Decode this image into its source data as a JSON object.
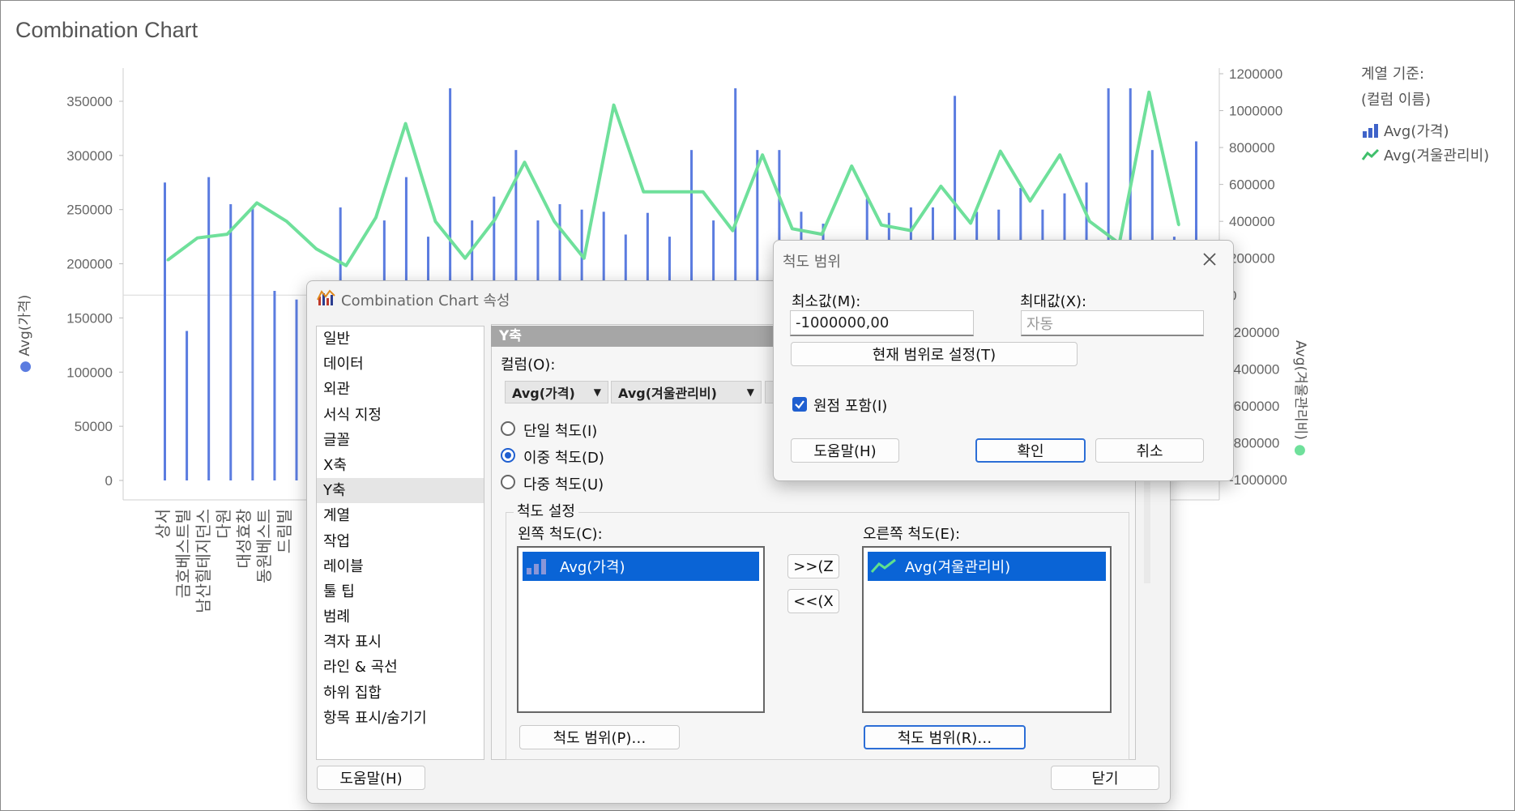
{
  "chart": {
    "title": "Combination Chart",
    "left_axis_title": "Avg(가격)",
    "right_axis_title": "Avg(겨울관리비)",
    "left_ticks": [
      "0",
      "50000",
      "100000",
      "150000",
      "200000",
      "250000",
      "300000",
      "350000"
    ],
    "right_ticks": [
      "1200000",
      "1000000",
      "800000",
      "600000",
      "400000",
      "200000",
      "0",
      "-200000",
      "-400000",
      "-600000",
      "-800000",
      "-1000000"
    ],
    "x_labels": [
      "상서",
      "금호베스트빌",
      "남산힐테지던스",
      "다원",
      "대성효창",
      "동원베스트",
      "드림빌"
    ],
    "bar_color": "#5b7ce0",
    "line_color": "#6fe09b"
  },
  "chart_data": {
    "type": "bar",
    "series": [
      {
        "name": "Avg(가격)",
        "type": "bar",
        "axis": "left",
        "values": [
          275000,
          138000,
          280000,
          255000,
          252000,
          175000,
          167000,
          167000,
          252000,
          145000,
          240000,
          280000,
          225000,
          362000,
          240000,
          262000,
          305000,
          240000,
          255000,
          250000,
          248000,
          227000,
          247000,
          225000,
          305000,
          240000,
          362000,
          305000,
          305000,
          248000,
          237000,
          202000,
          260000,
          247000,
          252000,
          252000,
          355000,
          248000,
          250000,
          270000,
          250000,
          265000,
          275000,
          362000,
          362000,
          305000,
          225000,
          313000
        ]
      },
      {
        "name": "Avg(겨울관리비)",
        "type": "line",
        "axis": "right",
        "values": [
          190000,
          310000,
          330000,
          500000,
          400000,
          250000,
          160000,
          420000,
          930000,
          400000,
          200000,
          410000,
          720000,
          400000,
          200000,
          1030000,
          560000,
          560000,
          560000,
          350000,
          760000,
          360000,
          330000,
          700000,
          380000,
          350000,
          590000,
          390000,
          780000,
          510000,
          760000,
          400000,
          280000,
          1100000,
          380000
        ]
      }
    ],
    "ylim_left": [
      0,
      370000
    ],
    "ylim_right": [
      -1000000,
      1200000
    ],
    "ylabel_left": "Avg(가격)",
    "ylabel_right": "Avg(겨울관리비)"
  },
  "legend": {
    "header1": "계열 기준:",
    "header2": "(컬럼 이름)",
    "items": [
      "Avg(가격)",
      "Avg(겨울관리비)"
    ]
  },
  "props_dialog": {
    "title": "Combination Chart 속성",
    "nav_items": [
      "일반",
      "데이터",
      "외관",
      "서식 지정",
      "글꼴",
      "X축",
      "Y축",
      "계열",
      "작업",
      "레이블",
      "툴 팁",
      "범례",
      "격자 표시",
      "라인 & 곡선",
      "하위 집합",
      "항목 표시/숨기기"
    ],
    "selected_nav": "Y축",
    "section_title": "Y축",
    "columns_label": "컬럼(O):",
    "columns": [
      "Avg(가격)",
      "Avg(겨울관리비)"
    ],
    "radio_single": "단일 척도(I)",
    "radio_dual": "이중 척도(D)",
    "radio_multi": "다중 척도(U)",
    "scale_settings": "척도 설정",
    "left_scale_label": "왼쪽 척도(C):",
    "right_scale_label": "오른쪽 척도(E):",
    "left_item": "Avg(가격)",
    "right_item": "Avg(겨울관리비)",
    "move_right": ">>(Z",
    "move_left": "<<(X",
    "left_range_btn": "척도 범위(P)…",
    "right_range_btn": "척도 범위(R)…",
    "help_btn": "도움말(H)",
    "close_btn": "닫기"
  },
  "range_dialog": {
    "title": "척도 범위",
    "min_label": "최소값(M):",
    "max_label": "최대값(X):",
    "min_value": "-1000000,00",
    "max_placeholder": "자동",
    "set_current_btn": "현재 범위로 설정(T)",
    "include_origin": "원점 포함(I)",
    "help_btn": "도움말(H)",
    "ok_btn": "확인",
    "cancel_btn": "취소"
  }
}
